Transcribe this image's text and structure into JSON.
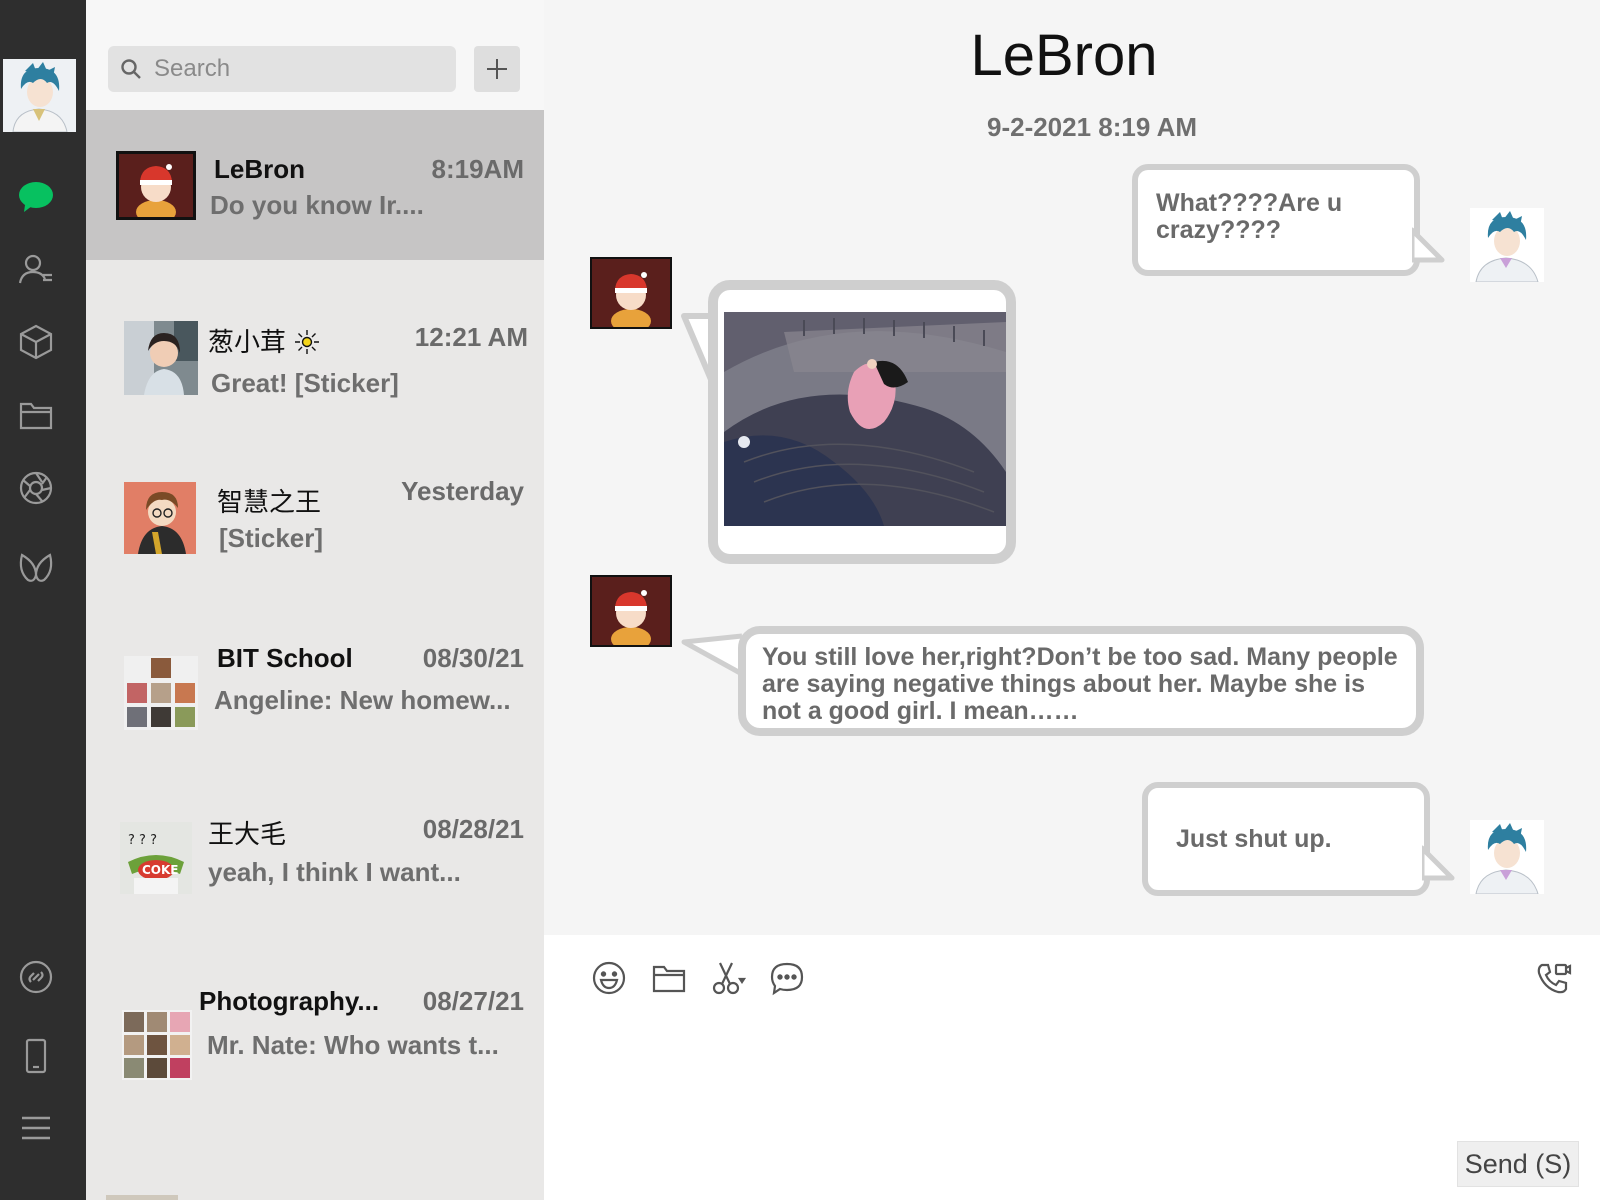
{
  "search": {
    "placeholder": "Search"
  },
  "rail": {
    "icons": [
      "chat-icon",
      "contacts-icon",
      "favorites-icon",
      "files-icon",
      "moments-icon",
      "mini-programs-icon",
      "link-icon",
      "phone-icon",
      "menu-icon"
    ]
  },
  "conversations": [
    {
      "name": "LeBron",
      "time": "8:19AM",
      "preview": "Do you know Ir...."
    },
    {
      "name": "葱小茸",
      "time": "12:21 AM",
      "preview": "Great! [Sticker]"
    },
    {
      "name": "智慧之王",
      "time": "Yesterday",
      "preview": "[Sticker]"
    },
    {
      "name": "BIT School",
      "time": "08/30/21",
      "preview": "Angeline: New homew..."
    },
    {
      "name": "王大毛",
      "time": "08/28/21",
      "preview": "yeah, I think I want..."
    },
    {
      "name": "Photography...",
      "time": "08/27/21",
      "preview": "Mr. Nate: Who wants t..."
    }
  ],
  "chat": {
    "title": "LeBron",
    "date": "9-2-2021 8:19 AM",
    "messages": [
      {
        "from": "me",
        "text": "What????Are u crazy????"
      },
      {
        "from": "peer",
        "type": "image"
      },
      {
        "from": "peer",
        "text": "You still love her,right?Don’t be too sad. Many people are saying negative things about her. Maybe she is not a good girl. I mean……"
      },
      {
        "from": "me",
        "text": "Just shut up."
      }
    ]
  },
  "composer": {
    "tools": [
      "emoji-icon",
      "folder-icon",
      "scissors-icon",
      "chat-history-icon",
      "call-icon"
    ],
    "send_label": "Send (S)"
  },
  "colors": {
    "accent": "#07c160",
    "rail": "#2e2e2e",
    "list": "#e9e8e7",
    "active": "#c6c5c5"
  }
}
